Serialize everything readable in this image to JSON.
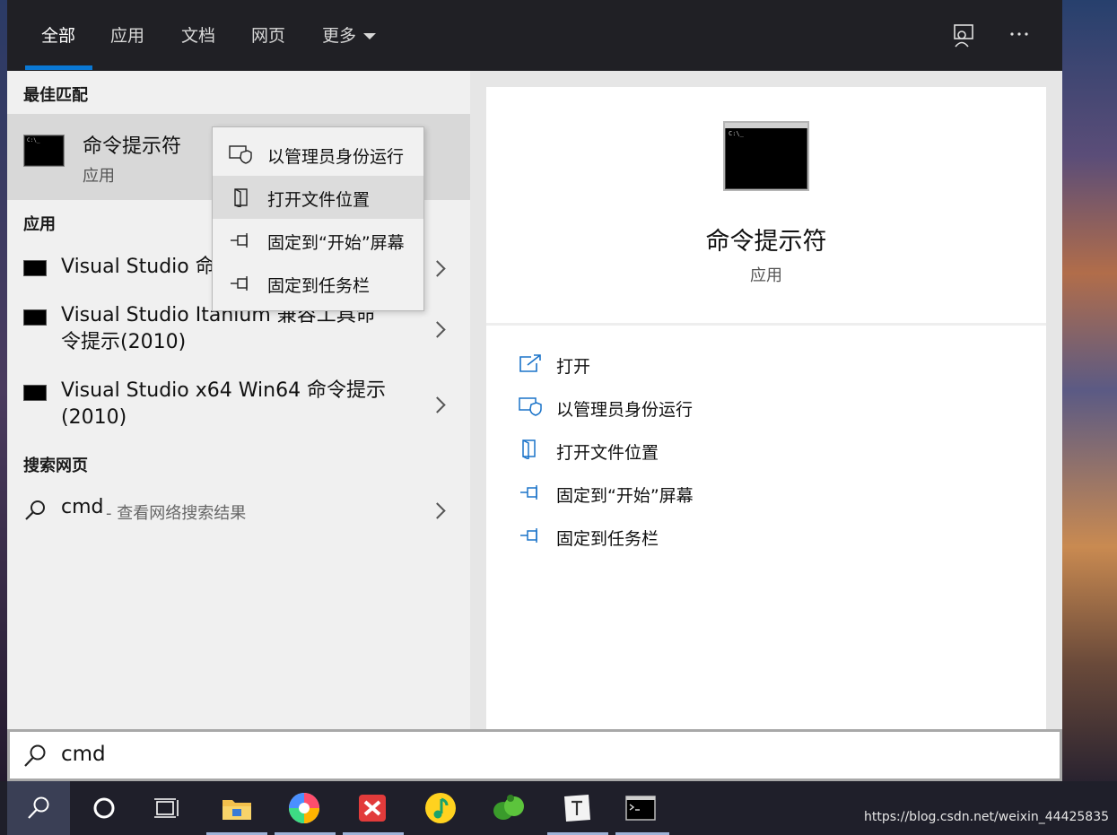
{
  "tabs": [
    {
      "label": "全部",
      "active": true
    },
    {
      "label": "应用"
    },
    {
      "label": "文档"
    },
    {
      "label": "网页"
    },
    {
      "label": "更多"
    }
  ],
  "top_icons": [
    "feedback-icon",
    "more-options-icon"
  ],
  "sections": {
    "best_match": "最佳匹配",
    "apps": "应用",
    "web": "搜索网页"
  },
  "best_match": {
    "title": "命令提示符",
    "subtitle": "应用",
    "icon_glyph": "C:\\_"
  },
  "apps": [
    {
      "label": "Visual Studio 命令提示(2010)",
      "visible_label": "Visual Studio 命"
    },
    {
      "label": "Visual Studio Itanium 兼容工具命令提示(2010)",
      "line1": "Visual Studio Itanium 兼容工具命",
      "line2": "令提示(2010)"
    },
    {
      "label": "Visual Studio x64 Win64 命令提示(2010)",
      "line1": "Visual Studio x64 Win64 命令提示",
      "line2": "(2010)"
    }
  ],
  "web": {
    "query": "cmd",
    "hint": "- 查看网络搜索结果"
  },
  "context_menu": [
    {
      "label": "以管理员身份运行",
      "icon": "shield-icon"
    },
    {
      "label": "打开文件位置",
      "icon": "folder-location-icon",
      "hover": true
    },
    {
      "label": "固定到“开始”屏幕",
      "icon": "pin-icon"
    },
    {
      "label": "固定到任务栏",
      "icon": "pin-icon"
    }
  ],
  "preview": {
    "title": "命令提示符",
    "subtitle": "应用",
    "icon_glyph": "C:\\_",
    "actions": [
      {
        "label": "打开",
        "icon": "open-icon"
      },
      {
        "label": "以管理员身份运行",
        "icon": "shield-icon"
      },
      {
        "label": "打开文件位置",
        "icon": "folder-location-icon"
      },
      {
        "label": "固定到“开始”屏幕",
        "icon": "pin-icon"
      },
      {
        "label": "固定到任务栏",
        "icon": "pin-icon"
      }
    ]
  },
  "search": {
    "value": "cmd"
  },
  "taskbar": {
    "items": [
      "search-icon",
      "cortana-icon",
      "task-view-icon",
      "file-explorer-icon",
      "browser-pinwheel-icon",
      "xmind-icon",
      "music-icon",
      "app-leaf-icon",
      "typora-icon",
      "cmd-icon"
    ]
  },
  "watermark": "https://blog.csdn.net/weixin_44425835",
  "colors": {
    "accent": "#0a78d4",
    "topbar": "#202025",
    "icon_blue": "#1a73c9"
  }
}
